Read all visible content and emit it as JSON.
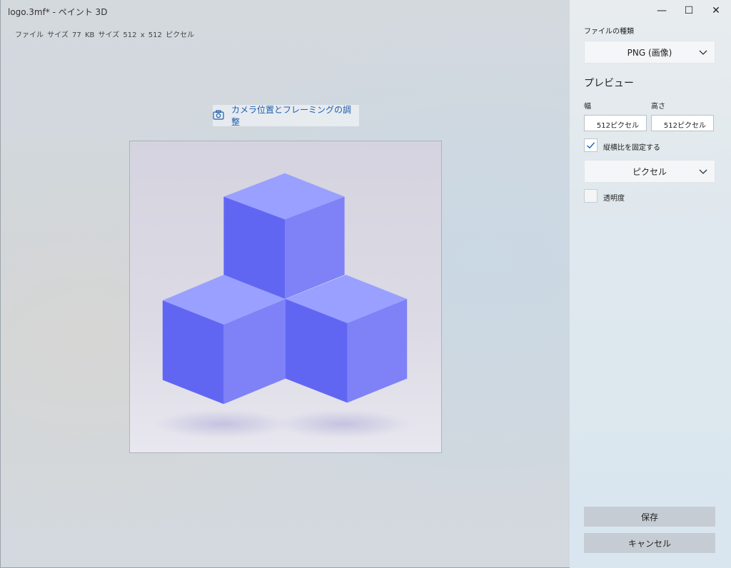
{
  "window": {
    "title": "logo.3mf* - ペイント 3D",
    "file_info": "ファイル サイズ  77 KB   サイズ  512 x 512 ピクセル",
    "minimize_glyph": "—",
    "maximize_glyph": "☐",
    "close_glyph": "✕"
  },
  "canvas": {
    "camera_button_label": "カメラ位置とフレーミングの調整",
    "camera_icon": "camera-icon",
    "cube_colors": {
      "top": "#99a0ff",
      "left": "#6166f2",
      "right": "#7e82f6"
    }
  },
  "panel": {
    "file_type_label": "ファイルの種類",
    "file_type_value": "PNG (画像)",
    "preview_heading": "プレビュー",
    "width_label": "幅",
    "height_label": "高さ",
    "width_value": "512ピクセル",
    "height_value": "512ピクセル",
    "lock_aspect_label": "縦横比を固定する",
    "lock_aspect_checked": true,
    "unit_value": "ピクセル",
    "transparency_label": "透明度",
    "transparency_checked": false,
    "save_label": "保存",
    "cancel_label": "キャンセル"
  }
}
